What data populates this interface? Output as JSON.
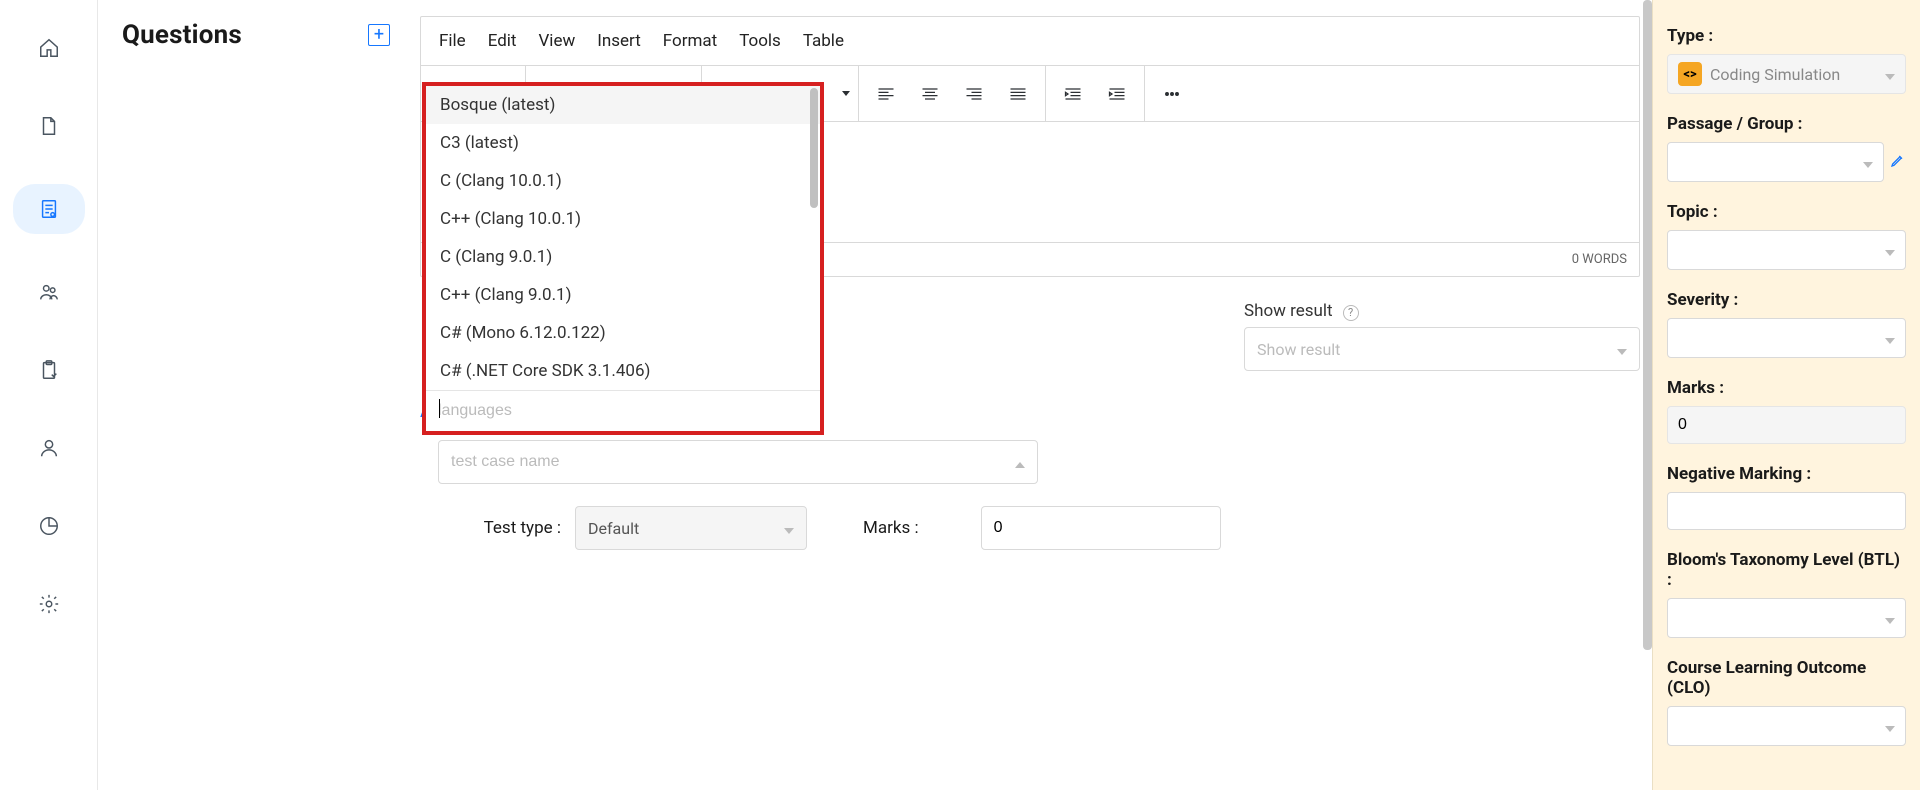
{
  "questions": {
    "title": "Questions"
  },
  "editor": {
    "menus": {
      "file": "File",
      "edit": "Edit",
      "view": "View",
      "insert": "Insert",
      "format": "Format",
      "tools": "Tools",
      "table": "Table"
    },
    "word_count_label": "0 WORDS"
  },
  "show_result": {
    "label": "Show result",
    "placeholder": "Show result"
  },
  "language_dropdown": {
    "options": [
      "Bosque (latest)",
      "C3 (latest)",
      "C (Clang 10.0.1)",
      "C++ (Clang 10.0.1)",
      "C (Clang 9.0.1)",
      "C++ (Clang 9.0.1)",
      "C# (Mono 6.12.0.122)",
      "C# (.NET Core SDK 3.1.406)"
    ],
    "search_placeholder": "languages"
  },
  "testcases": {
    "add_label": "Add test cases here:",
    "name_placeholder": "test case name",
    "test_type_label": "Test type",
    "test_type_value": "Default",
    "marks_label": "Marks",
    "marks_value": "0"
  },
  "props": {
    "type_label": "Type",
    "type_value": "Coding Simulation",
    "passage_label": "Passage / Group",
    "topic_label": "Topic",
    "severity_label": "Severity",
    "marks_label": "Marks",
    "marks_value": "0",
    "negmark_label": "Negative Marking",
    "btl_label": "Bloom's Taxonomy Level (BTL)",
    "clo_label": "Course Learning Outcome (CLO)"
  }
}
